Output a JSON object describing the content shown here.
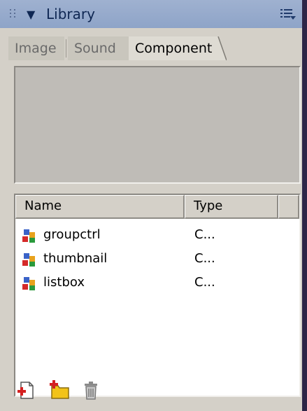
{
  "header": {
    "title": "Library",
    "collapse_icon": "triangle-down",
    "options_icon": "list-menu-icon"
  },
  "tabs": [
    {
      "label": "Image",
      "active": false
    },
    {
      "label": "Sound",
      "active": false
    },
    {
      "label": "Component",
      "active": true
    }
  ],
  "list": {
    "columns": [
      "Name",
      "Type"
    ],
    "rows": [
      {
        "name": "groupctrl",
        "type": "C..."
      },
      {
        "name": "thumbnail",
        "type": "C..."
      },
      {
        "name": "listbox",
        "type": "C..."
      }
    ]
  },
  "toolbar": {
    "icons": [
      "new-symbol-icon",
      "new-folder-icon",
      "delete-icon"
    ]
  },
  "colors": {
    "background": "#2d2547",
    "panel": "#d4d0c8",
    "header": "#8ea4c8"
  }
}
